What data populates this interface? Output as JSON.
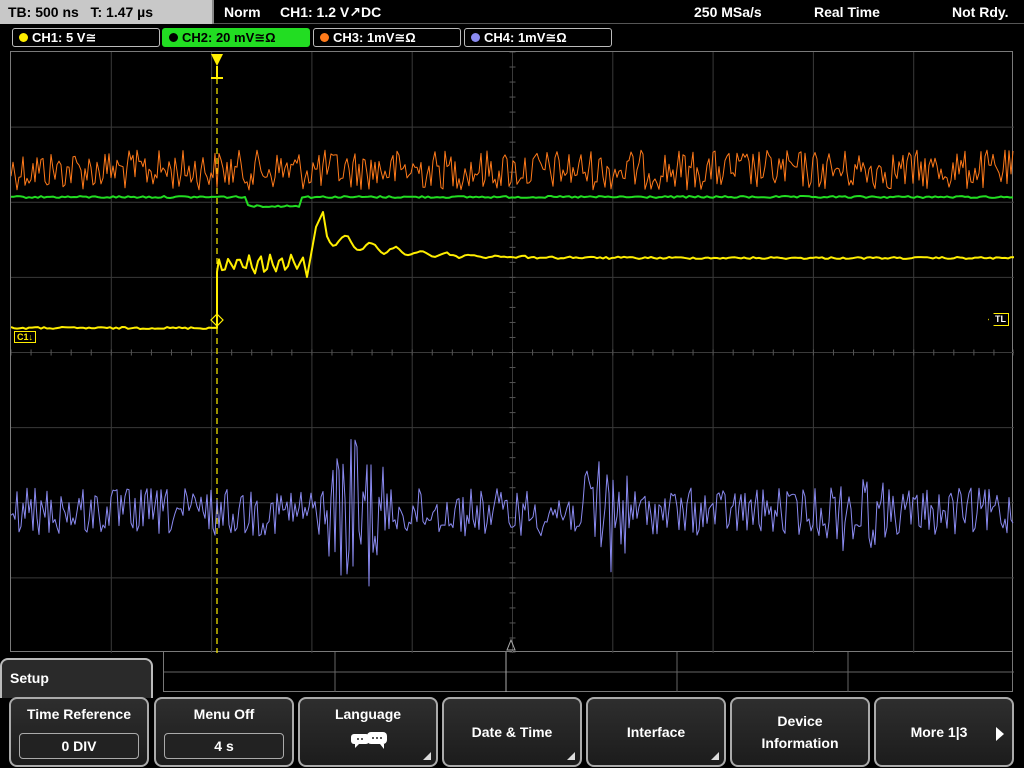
{
  "status": {
    "timebase": "TB: 500 ns",
    "trigger_time": "T: 1.47 µs",
    "mode": "Norm",
    "trigger_info": "CH1: 1.2 V",
    "trigger_coupling": "DC",
    "sample_rate": "250 MSa/s",
    "acq_mode": "Real Time",
    "state": "Not Rdy."
  },
  "channels": [
    {
      "label": "CH1: 5 V≅",
      "color": "#ffee00",
      "active": false
    },
    {
      "label": "CH2: 20 mV≅Ω",
      "color": "#22dd22",
      "active": true
    },
    {
      "label": "CH3: 1mV≅Ω",
      "color": "#ff7a1a",
      "active": false
    },
    {
      "label": "CH4: 1mV≅Ω",
      "color": "#8a8af0",
      "active": false
    }
  ],
  "markers": {
    "trigger_level": "TL",
    "ch1_ref": "C1"
  },
  "menu": {
    "title": "Setup",
    "keys": [
      {
        "label": "Time Reference",
        "value": "0 DIV"
      },
      {
        "label": "Menu Off",
        "value": "4 s"
      },
      {
        "label": "Language"
      },
      {
        "label": "Date & Time"
      },
      {
        "label": "Interface"
      },
      {
        "label": "Device Information"
      },
      {
        "label": "More 1|3"
      }
    ]
  },
  "waveforms": {
    "ch3_orange": "#ff7a1a",
    "ch2_green": "#22dd22",
    "ch1_yellow": "#ffee00",
    "ch4_blue": "#8a8af0"
  }
}
